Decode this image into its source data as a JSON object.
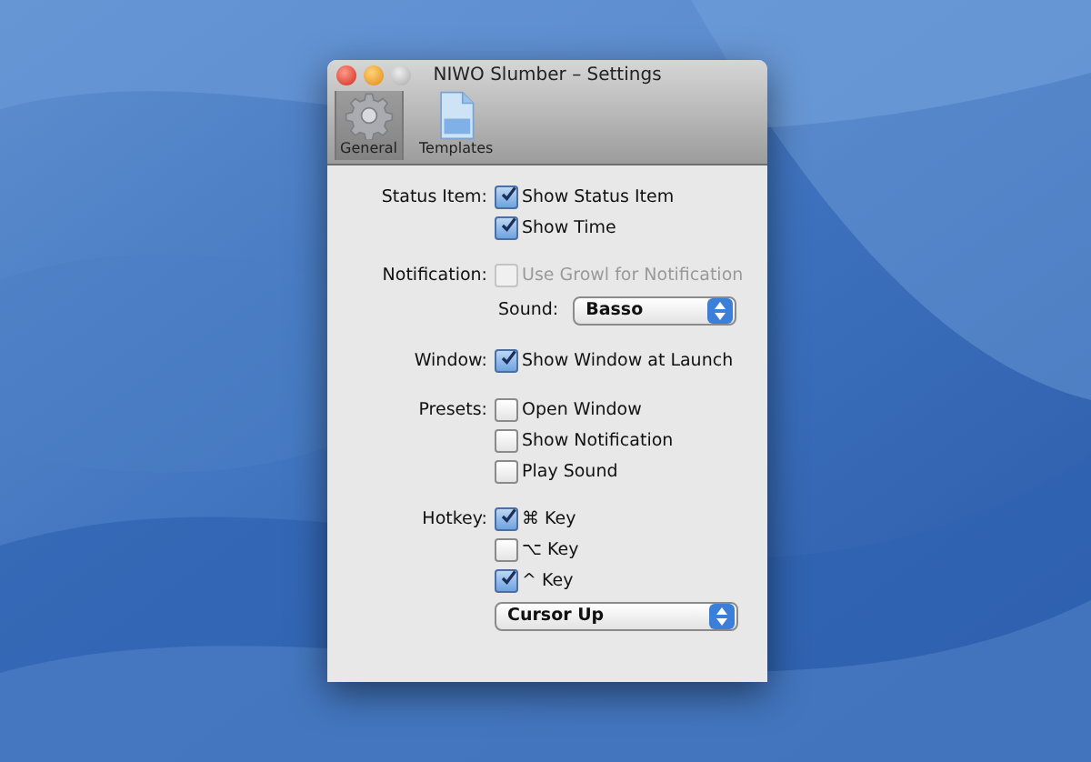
{
  "window": {
    "title": "NIWO Slumber – Settings"
  },
  "toolbar": [
    {
      "label": "General",
      "kind": "gear",
      "selected": true
    },
    {
      "label": "Templates",
      "kind": "document",
      "selected": false
    }
  ],
  "sections": [
    {
      "label": "Status Item:",
      "items": [
        {
          "kind": "checkbox",
          "label": "Show Status Item",
          "checked": true,
          "disabled": false
        },
        {
          "kind": "checkbox",
          "label": "Show Time",
          "checked": true,
          "disabled": false
        }
      ]
    },
    {
      "label": "Notification:",
      "items": [
        {
          "kind": "checkbox",
          "label": "Use Growl for Notification",
          "checked": false,
          "disabled": true
        },
        {
          "kind": "popup",
          "label": "Sound:",
          "value": "Basso"
        }
      ]
    },
    {
      "label": "Window:",
      "items": [
        {
          "kind": "checkbox",
          "label": "Show Window at Launch",
          "checked": true,
          "disabled": false
        }
      ]
    },
    {
      "label": "Presets:",
      "items": [
        {
          "kind": "checkbox",
          "label": "Open Window",
          "checked": false,
          "disabled": false
        },
        {
          "kind": "checkbox",
          "label": "Show Notification",
          "checked": false,
          "disabled": false
        },
        {
          "kind": "checkbox",
          "label": "Play Sound",
          "checked": false,
          "disabled": false
        }
      ]
    },
    {
      "label": "Hotkey:",
      "items": [
        {
          "kind": "checkbox",
          "label": "⌘ Key",
          "checked": true,
          "disabled": false
        },
        {
          "kind": "checkbox",
          "label": "⌥ Key",
          "checked": false,
          "disabled": false
        },
        {
          "kind": "checkbox",
          "label": "^ Key",
          "checked": true,
          "disabled": false
        },
        {
          "kind": "popup",
          "value": "Cursor Up"
        }
      ]
    }
  ]
}
